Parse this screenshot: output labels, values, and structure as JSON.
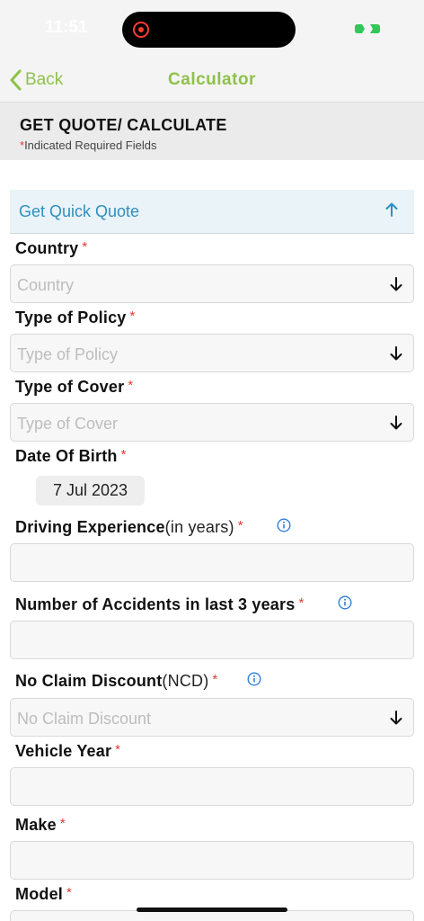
{
  "status": {
    "time": "11:51"
  },
  "nav": {
    "back_label": "Back",
    "title": "Calculator"
  },
  "header": {
    "title": "GET QUOTE/ CALCULATE",
    "required_star": "*",
    "required_note": "Indicated Required Fields"
  },
  "accordion": {
    "label": "Get Quick Quote",
    "icon": "arrow-up-icon"
  },
  "form": {
    "required_marker": "*",
    "country": {
      "label": "Country",
      "placeholder": "Country"
    },
    "policy_type": {
      "label": "Type of Policy",
      "placeholder": "Type of Policy"
    },
    "cover_type": {
      "label": "Type of Cover",
      "placeholder": "Type of Cover"
    },
    "dob": {
      "label": "Date Of Birth",
      "value": "7 Jul 2023"
    },
    "driving_experience": {
      "label": "Driving Experience",
      "suffix": "(in years)",
      "value": ""
    },
    "accidents": {
      "label": "Number of Accidents in last 3 years",
      "value": ""
    },
    "ncd": {
      "label": "No Claim Discount",
      "suffix": "(NCD)",
      "placeholder": "No Claim Discount"
    },
    "vehicle_year": {
      "label": "Vehicle Year",
      "value": ""
    },
    "make": {
      "label": "Make",
      "value": ""
    },
    "model": {
      "label": "Model",
      "value": ""
    }
  },
  "colors": {
    "accent": "#8fc14a",
    "link": "#2f8fbf",
    "required": "#e53935",
    "accordion_bg": "#e9f3f8"
  }
}
